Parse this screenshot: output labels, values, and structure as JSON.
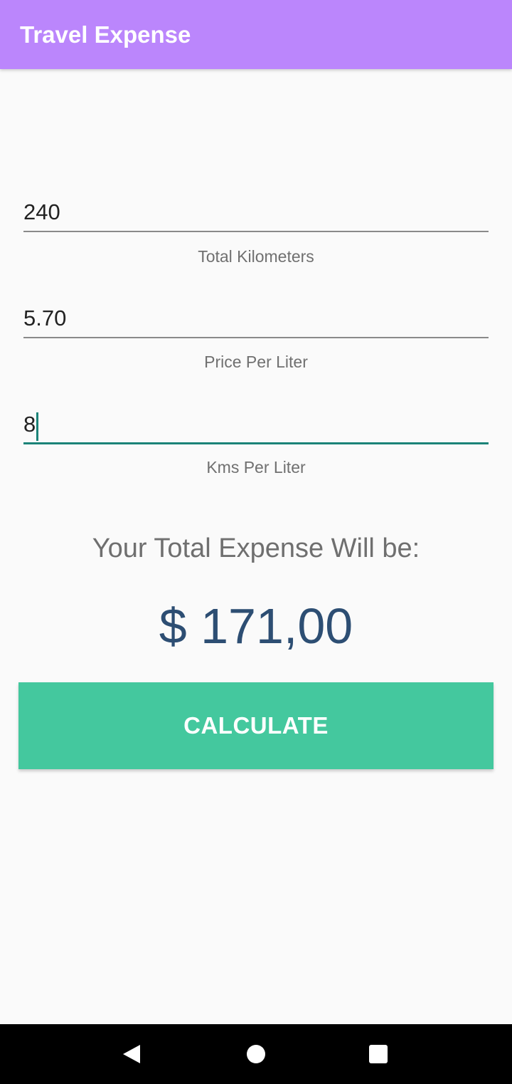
{
  "app_bar": {
    "title": "Travel Expense",
    "color": "#bb86fc"
  },
  "form": {
    "fields": [
      {
        "value": "240",
        "label": "Total Kilometers",
        "focused": false
      },
      {
        "value": "5.70",
        "label": "Price Per Liter",
        "focused": false
      },
      {
        "value": "8",
        "label": "Kms Per Liter",
        "focused": true
      }
    ],
    "accent_color": "#1b8378"
  },
  "result": {
    "heading": "Your Total Expense Will be:",
    "value": "$ 171,00",
    "color": "#2d4e73"
  },
  "action": {
    "calculate_label": "CALCULATE",
    "color": "#44c89e"
  },
  "nav": {
    "back_icon": "back-triangle-icon",
    "home_icon": "home-circle-icon",
    "recents_icon": "recents-square-icon"
  }
}
